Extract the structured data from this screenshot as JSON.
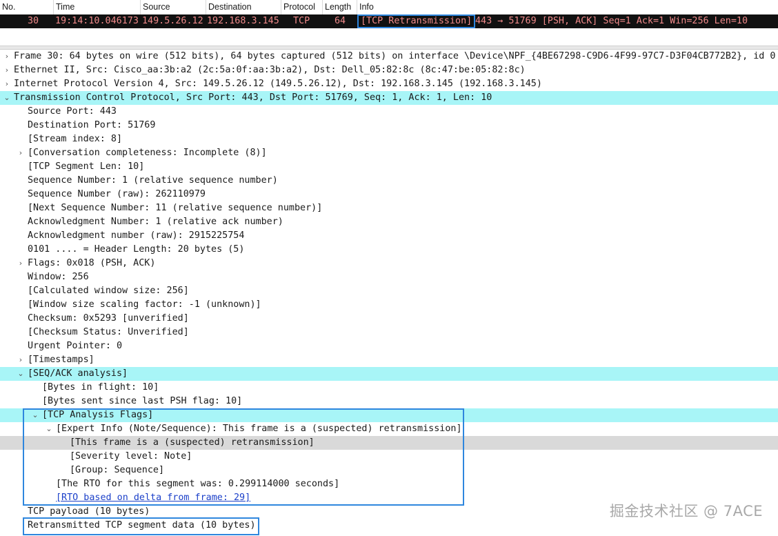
{
  "packet_list": {
    "columns": [
      "No.",
      "Time",
      "Source",
      "Destination",
      "Protocol",
      "Length",
      "Info"
    ],
    "row": {
      "no": "30",
      "time": "19:14:10.046173",
      "source": "149.5.26.12",
      "destination": "192.168.3.145",
      "protocol": "TCP",
      "length": "64",
      "info_tag": "[TCP Retransmission]",
      "info_rest": "443 → 51769 [PSH, ACK] Seq=1 Ack=1 Win=256 Len=10"
    }
  },
  "details": [
    {
      "text": "Frame 30: 64 bytes on wire (512 bits), 64 bytes captured (512 bits) on interface \\Device\\NPF_{4BE67298-C9D6-4F99-97C7-D3F04CB772B2}, id 0",
      "arrow": "collapsed"
    },
    {
      "text": "Ethernet II, Src: Cisco_aa:3b:a2 (2c:5a:0f:aa:3b:a2), Dst: Dell_05:82:8c (8c:47:be:05:82:8c)",
      "arrow": "collapsed"
    },
    {
      "text": "Internet Protocol Version 4, Src: 149.5.26.12 (149.5.26.12), Dst: 192.168.3.145 (192.168.3.145)",
      "arrow": "collapsed"
    },
    {
      "text": "Transmission Control Protocol, Src Port: 443, Dst Port: 51769, Seq: 1, Ack: 1, Len: 10",
      "arrow": "expanded"
    },
    {
      "text": "Source Port: 443",
      "arrow": "none"
    },
    {
      "text": "Destination Port: 51769",
      "arrow": "none"
    },
    {
      "text": "[Stream index: 8]",
      "arrow": "none"
    },
    {
      "text": "[Conversation completeness: Incomplete (8)]",
      "arrow": "collapsed"
    },
    {
      "text": "[TCP Segment Len: 10]",
      "arrow": "none"
    },
    {
      "text": "Sequence Number: 1    (relative sequence number)",
      "arrow": "none"
    },
    {
      "text": "Sequence Number (raw): 262110979",
      "arrow": "none"
    },
    {
      "text": "[Next Sequence Number: 11    (relative sequence number)]",
      "arrow": "none"
    },
    {
      "text": "Acknowledgment Number: 1    (relative ack number)",
      "arrow": "none"
    },
    {
      "text": "Acknowledgment number (raw): 2915225754",
      "arrow": "none"
    },
    {
      "text": "0101 .... = Header Length: 20 bytes (5)",
      "arrow": "none"
    },
    {
      "text": "Flags: 0x018 (PSH, ACK)",
      "arrow": "collapsed"
    },
    {
      "text": "Window: 256",
      "arrow": "none"
    },
    {
      "text": "[Calculated window size: 256]",
      "arrow": "none"
    },
    {
      "text": "[Window size scaling factor: -1 (unknown)]",
      "arrow": "none"
    },
    {
      "text": "Checksum: 0x5293 [unverified]",
      "arrow": "none"
    },
    {
      "text": "[Checksum Status: Unverified]",
      "arrow": "none"
    },
    {
      "text": "Urgent Pointer: 0",
      "arrow": "none"
    },
    {
      "text": "[Timestamps]",
      "arrow": "collapsed"
    },
    {
      "text": "[SEQ/ACK analysis]",
      "arrow": "expanded"
    },
    {
      "text": "[Bytes in flight: 10]",
      "arrow": "none"
    },
    {
      "text": "[Bytes sent since last PSH flag: 10]",
      "arrow": "none"
    },
    {
      "text": "[TCP Analysis Flags]",
      "arrow": "expanded"
    },
    {
      "text": "[Expert Info (Note/Sequence): This frame is a (suspected) retransmission]",
      "arrow": "expanded"
    },
    {
      "text": "[This frame is a (suspected) retransmission]",
      "arrow": "none"
    },
    {
      "text": "[Severity level: Note]",
      "arrow": "none"
    },
    {
      "text": "[Group: Sequence]",
      "arrow": "none"
    },
    {
      "text": "[The RTO for this segment was: 0.299114000 seconds]",
      "arrow": "none"
    },
    {
      "text": "[RTO based on delta from frame: 29]",
      "arrow": "none"
    },
    {
      "text": "TCP payload (10 bytes)",
      "arrow": "none"
    },
    {
      "text": "Retransmitted TCP segment data (10 bytes)",
      "arrow": "none"
    }
  ],
  "watermark": "掘金技术社区 @ 7ACE",
  "colors": {
    "selected_row_bg": "#111111",
    "selected_row_fg": "#f08a8a",
    "section_highlight": "#a8f5f7",
    "selection_gray": "#d9d9d9",
    "annotation_box": "#2e86de",
    "link": "#1a3fc9"
  }
}
